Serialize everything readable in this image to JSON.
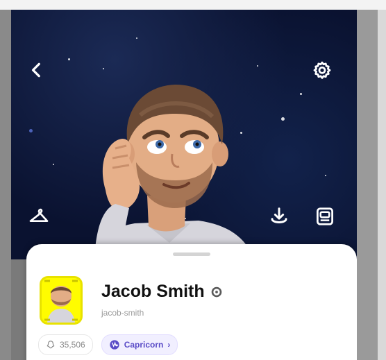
{
  "header": {
    "back_icon": "chevron-left-icon",
    "settings_icon": "gear-icon"
  },
  "actions": {
    "left_icon": "hanger-icon",
    "right_icons": [
      "download-icon",
      "story-frame-icon"
    ]
  },
  "profile": {
    "name": "Jacob Smith",
    "username": "jacob-smith",
    "verified_icon": "settings-badge-icon",
    "snap_score": "35,506",
    "zodiac": "Capricorn",
    "zodiac_chevron": "›",
    "zodiac_color": "#5a4cc7",
    "tile_color": "#fffc00"
  },
  "colors": {
    "background": "#0a1230",
    "card": "#ffffff"
  }
}
